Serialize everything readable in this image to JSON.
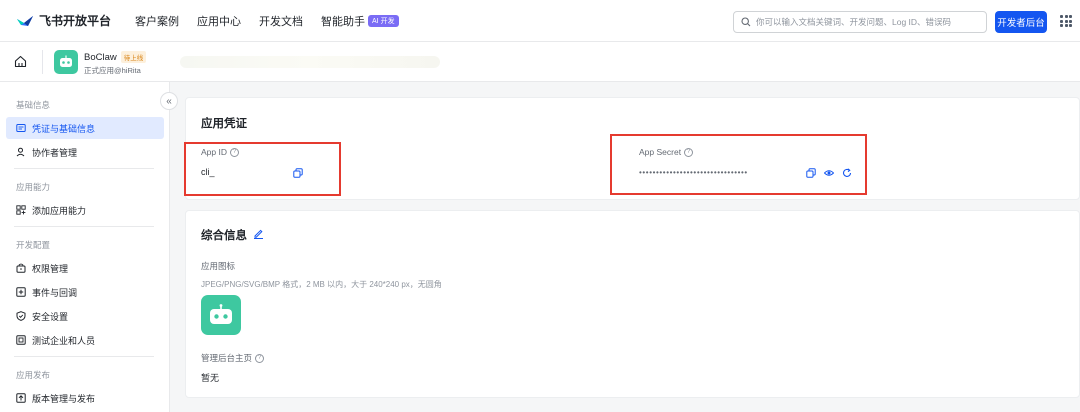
{
  "topnav": {
    "brand": "飞书开放平台",
    "links": [
      "客户案例",
      "应用中心",
      "开发文档",
      "智能助手"
    ],
    "ai_badge": "AI 开发",
    "search_placeholder": "你可以输入文档关键词、开发问题、Log ID、错误码",
    "dev_button": "开发者后台",
    "accent": "#1456f0"
  },
  "app": {
    "name": "BoClaw",
    "status": "待上线",
    "subtitle": "正式应用@hiRita",
    "avatar_color": "#3ec8a0"
  },
  "sidebar": {
    "sections": [
      {
        "title": "基础信息",
        "items": [
          {
            "label": "凭证与基础信息",
            "icon": "credential-icon",
            "active": true
          },
          {
            "label": "协作者管理",
            "icon": "user-icon",
            "active": false
          }
        ]
      },
      {
        "title": "应用能力",
        "items": [
          {
            "label": "添加应用能力",
            "icon": "add-capability-icon",
            "active": false
          }
        ]
      },
      {
        "title": "开发配置",
        "items": [
          {
            "label": "权限管理",
            "icon": "lock-icon",
            "active": false
          },
          {
            "label": "事件与回调",
            "icon": "event-icon",
            "active": false
          },
          {
            "label": "安全设置",
            "icon": "shield-icon",
            "active": false
          },
          {
            "label": "测试企业和人员",
            "icon": "test-icon",
            "active": false
          }
        ]
      },
      {
        "title": "应用发布",
        "items": [
          {
            "label": "版本管理与发布",
            "icon": "upload-icon",
            "active": false
          }
        ]
      }
    ]
  },
  "credentials": {
    "title": "应用凭证",
    "app_id_label": "App ID",
    "app_id_value": "cli_",
    "app_secret_label": "App Secret",
    "app_secret_value": "••••••••••••••••••••••••••••••••"
  },
  "general": {
    "title": "综合信息",
    "icon_label": "应用图标",
    "icon_hint": "JPEG/PNG/SVG/BMP 格式，2 MB 以内，大于 240*240 px，无圆角",
    "admin_label": "管理后台主页",
    "admin_value": "暂无"
  }
}
